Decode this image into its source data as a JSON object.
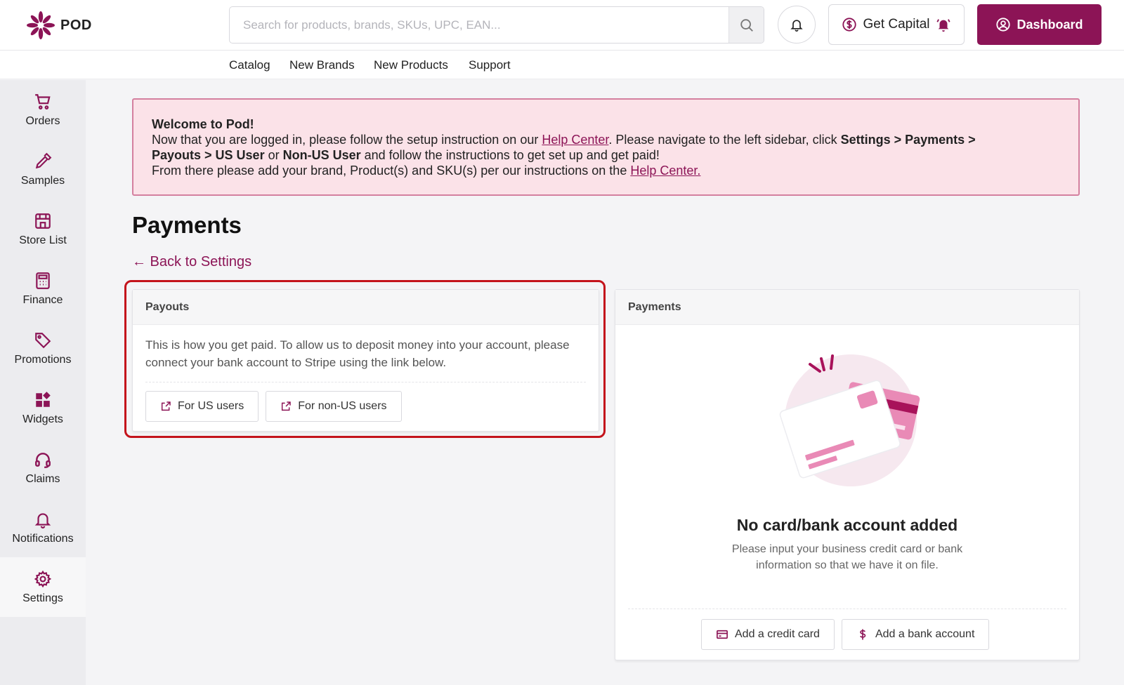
{
  "header": {
    "logo_text": "POD",
    "search_placeholder": "Search for products, brands, SKUs, UPC, EAN...",
    "capital_label": "Get Capital",
    "dashboard_label": "Dashboard"
  },
  "subnav": [
    "Catalog",
    "New Brands",
    "New Products",
    "Support"
  ],
  "sidebar": {
    "items": [
      {
        "label": "Orders",
        "icon": "cart-icon"
      },
      {
        "label": "Samples",
        "icon": "pen-icon"
      },
      {
        "label": "Store List",
        "icon": "store-icon"
      },
      {
        "label": "Finance",
        "icon": "calculator-icon"
      },
      {
        "label": "Promotions",
        "icon": "tag-icon"
      },
      {
        "label": "Widgets",
        "icon": "widgets-icon"
      },
      {
        "label": "Claims",
        "icon": "headset-icon"
      },
      {
        "label": "Notifications",
        "icon": "bell-icon"
      },
      {
        "label": "Settings",
        "icon": "gear-icon"
      }
    ],
    "active": "Settings"
  },
  "banner": {
    "title": "Welcome to Pod!",
    "line1_pre": "Now that you are logged in, please follow the setup instruction on our ",
    "help_link": "Help Center",
    "line1_mid": ". Please navigate to the left sidebar, click ",
    "bold_path1": "Settings > Payments >",
    "bold_path2": "Payouts > US User",
    "or_text": " or ",
    "bold_path3": "Non-US User",
    "line2_post": " and follow the instructions to get set up and get paid!",
    "line3_pre": "From there please add your brand, Product(s) and SKU(s) per our instructions on the ",
    "help_link2": "Help Center."
  },
  "page": {
    "title": "Payments",
    "back_link": "← Back to Settings"
  },
  "payouts": {
    "heading": "Payouts",
    "description": "This is how you get paid. To allow us to deposit money into your account, please connect your bank account to Stripe using the link below.",
    "us_button": "For US users",
    "non_us_button": "For non-US users"
  },
  "payments": {
    "heading": "Payments",
    "empty_title": "No card/bank account added",
    "empty_desc": "Please input your business credit card or bank information so that we have it on file.",
    "add_card": "Add a credit card",
    "add_bank": "Add a bank account"
  },
  "colors": {
    "brand": "#8c1456",
    "banner_bg": "#fbe2e8",
    "highlight": "#c4141c"
  }
}
